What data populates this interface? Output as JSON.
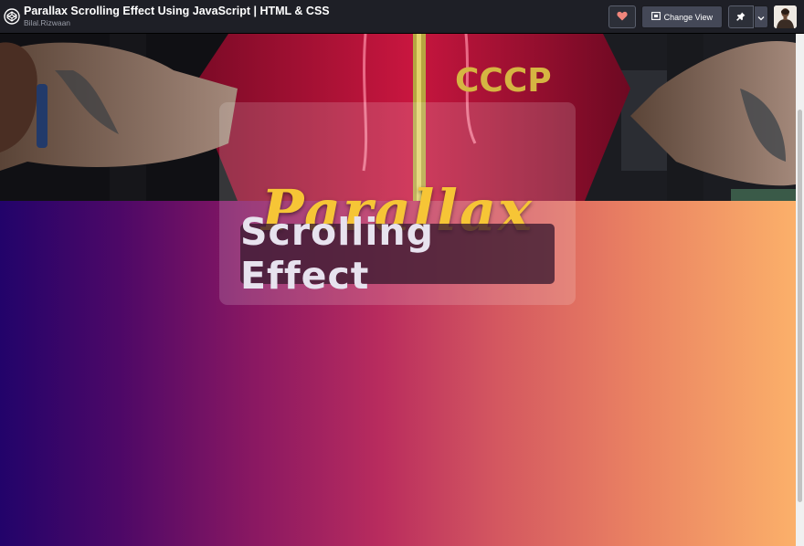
{
  "header": {
    "title": "Parallax Scrolling Effect Using JavaScript | HTML & CSS",
    "author": "Bilal.Rizwaan",
    "change_view_label": "Change View"
  },
  "hero": {
    "shirt_text": "CCCP"
  },
  "preview": {
    "heading": "Parallax",
    "subheading": "Scrolling Effect"
  },
  "colors": {
    "gradient_start": "#22036a",
    "gradient_end": "#fbb06a",
    "heading_color": "#f6c536"
  }
}
